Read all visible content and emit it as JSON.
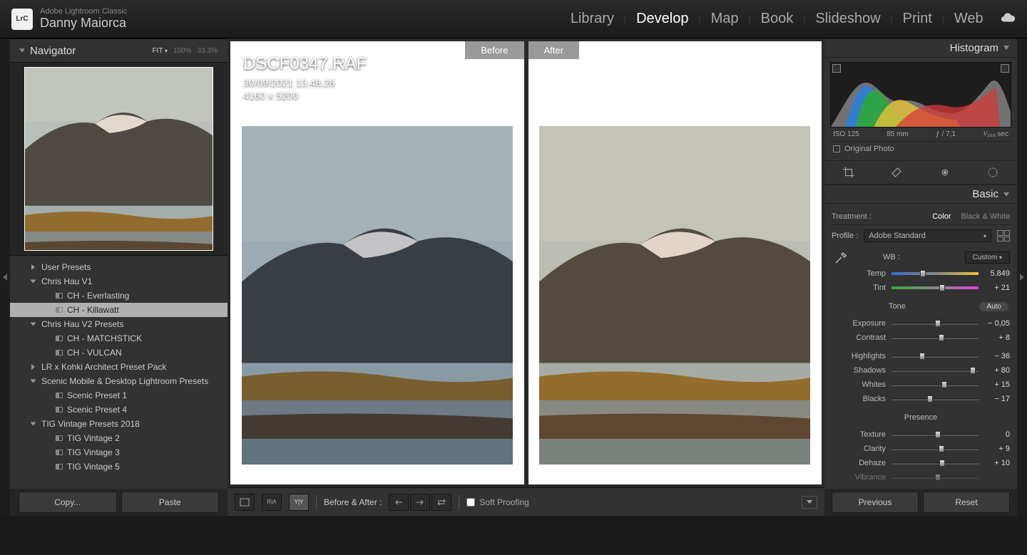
{
  "app": {
    "name": "Adobe Lightroom Classic",
    "user": "Danny Maiorca",
    "icon_label": "LrC"
  },
  "modules": [
    "Library",
    "Develop",
    "Map",
    "Book",
    "Slideshow",
    "Print",
    "Web"
  ],
  "active_module": "Develop",
  "navigator": {
    "title": "Navigator",
    "zoom_modes": [
      "FIT",
      "100%",
      "33.3%"
    ],
    "active_zoom": "FIT"
  },
  "presets": {
    "groups": [
      {
        "name": "User Presets",
        "open": false,
        "items": []
      },
      {
        "name": "Chris Hau V1",
        "open": true,
        "items": [
          {
            "name": "CH - Everlasting",
            "selected": false
          },
          {
            "name": "CH - Killawatt",
            "selected": true
          }
        ]
      },
      {
        "name": "Chris Hau V2 Presets",
        "open": true,
        "items": [
          {
            "name": "CH - MATCHSTICK",
            "selected": false
          },
          {
            "name": "CH - VULCAN",
            "selected": false
          }
        ]
      },
      {
        "name": "LR x Kohki Architect Preset Pack",
        "open": false,
        "items": []
      },
      {
        "name": "Scenic Mobile & Desktop Lightroom Presets",
        "open": true,
        "items": [
          {
            "name": "Scenic Preset 1",
            "selected": false
          },
          {
            "name": "Scenic Preset 4",
            "selected": false
          }
        ]
      },
      {
        "name": "TIG Vintage Presets 2018",
        "open": true,
        "items": [
          {
            "name": "TIG Vintage 2",
            "selected": false
          },
          {
            "name": "TIG Vintage 3",
            "selected": false
          },
          {
            "name": "TIG Vintage 5",
            "selected": false
          }
        ]
      }
    ]
  },
  "left_buttons": {
    "copy": "Copy...",
    "paste": "Paste"
  },
  "compare": {
    "before_label": "Before",
    "after_label": "After",
    "overlay": {
      "filename": "DSCF0347.RAF",
      "datetime": "30/09/2021 13.48.26",
      "dimensions": "4160 x 5200"
    }
  },
  "toolbar": {
    "compare_label": "Before & After :",
    "soft_proofing": "Soft Proofing"
  },
  "histogram": {
    "title": "Histogram",
    "exif": {
      "iso": "ISO 125",
      "focal": "85 mm",
      "aperture": "ƒ / 7,1",
      "shutter_pre": "¹⁄",
      "shutter_val": "₂₅₀",
      "shutter_suf": " sec"
    },
    "original_photo": "Original Photo"
  },
  "basic": {
    "title": "Basic",
    "treatment_label": "Treatment :",
    "treatment_options": [
      "Color",
      "Black & White"
    ],
    "treatment_active": "Color",
    "profile_label": "Profile :",
    "profile_value": "Adobe Standard",
    "wb_label": "WB :",
    "wb_value": "Custom",
    "sliders": {
      "temp": {
        "label": "Temp",
        "value": "5.849",
        "pos": 33
      },
      "tint": {
        "label": "Tint",
        "value": "+ 21",
        "pos": 55
      },
      "tone_header": "Tone",
      "auto_label": "Auto",
      "exposure": {
        "label": "Exposure",
        "value": "− 0,05",
        "pos": 50
      },
      "contrast": {
        "label": "Contrast",
        "value": "+ 8",
        "pos": 54
      },
      "highlights": {
        "label": "Highlights",
        "value": "− 36",
        "pos": 32
      },
      "shadows": {
        "label": "Shadows",
        "value": "+ 80",
        "pos": 90
      },
      "whites": {
        "label": "Whites",
        "value": "+ 15",
        "pos": 57
      },
      "blacks": {
        "label": "Blacks",
        "value": "− 17",
        "pos": 41
      },
      "presence_header": "Presence",
      "texture": {
        "label": "Texture",
        "value": "0",
        "pos": 50
      },
      "clarity": {
        "label": "Clarity",
        "value": "+ 9",
        "pos": 54
      },
      "dehaze": {
        "label": "Dehaze",
        "value": "+ 10",
        "pos": 55
      },
      "vibrance": {
        "label": "Vibrance",
        "value": "",
        "pos": 50
      }
    }
  },
  "right_buttons": {
    "previous": "Previous",
    "reset": "Reset"
  }
}
